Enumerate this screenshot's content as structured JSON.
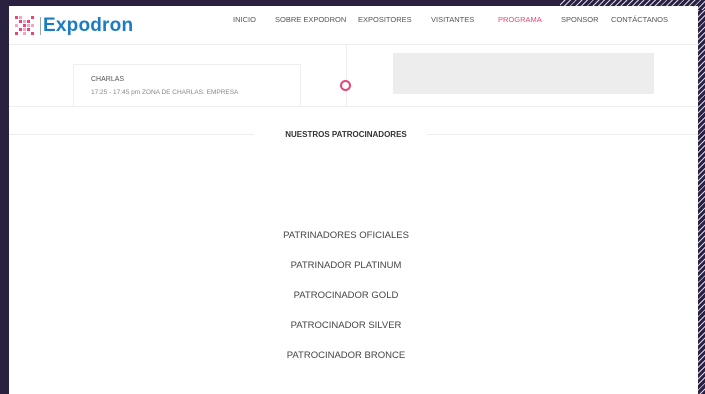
{
  "header": {
    "logo_text": "Expodron",
    "nav": [
      {
        "label": "INICIO",
        "active": false
      },
      {
        "label": "SOBRE EXPODRON",
        "active": false
      },
      {
        "label": "EXPOSITORES",
        "active": false
      },
      {
        "label": "VISITANTES",
        "active": false
      },
      {
        "label": "PROGRAMA",
        "active": true
      },
      {
        "label": "SPONSOR",
        "active": false
      },
      {
        "label": "CONTÁCTANOS",
        "active": false
      }
    ]
  },
  "session": {
    "title": "CHARLAS",
    "detail": "17:25 - 17:45 pm  ZONA DE CHARLAS: EMPRESA"
  },
  "section": {
    "title": "NUESTROS PATROCINADORES",
    "sponsors": [
      "PATRINADORES OFICIALES",
      "PATRINADOR PLATINUM",
      "PATROCINADOR GOLD",
      "PATROCINADOR SILVER",
      "PATROCINADOR BRONCE"
    ]
  },
  "colors": {
    "brand_blue": "#1c7cc3",
    "accent_pink": "#e8457a",
    "frame_dark": "#2a2140"
  }
}
